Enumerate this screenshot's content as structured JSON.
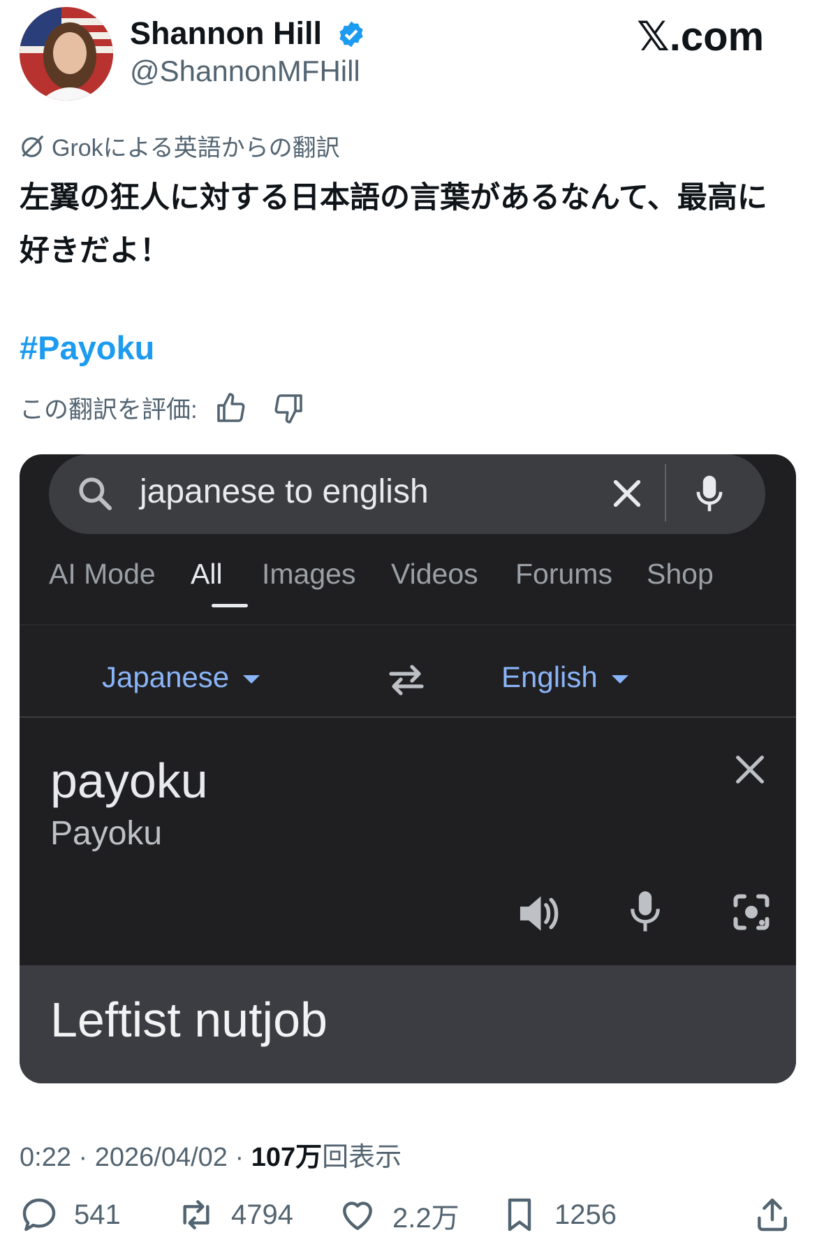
{
  "author": {
    "display_name": "Shannon Hill",
    "handle": "@ShannonMFHill",
    "verified": true
  },
  "site_label": "𝕏.com",
  "translation_note": "Grokによる英語からの翻訳",
  "post_text": "左翼の狂人に対する日本語の言葉があるなんて、最高に好きだよ！",
  "hashtag": "#Payoku",
  "rate_translation_label": "この翻訳を評価:",
  "screenshot": {
    "search_query": "japanese to english",
    "tabs": [
      "AI Mode",
      "All",
      "Images",
      "Videos",
      "Forums",
      "Shop"
    ],
    "active_tab": "All",
    "source_language": "Japanese",
    "target_language": "English",
    "source_text": "payoku",
    "source_romanization": "Payoku",
    "result_text": "Leftist nutjob"
  },
  "meta": {
    "time": "0:22",
    "date": "2026/04/02",
    "views_count": "107万",
    "views_label": "回表示"
  },
  "actions": {
    "replies": "541",
    "reposts": "4794",
    "likes": "2.2万",
    "bookmarks": "1256"
  },
  "colors": {
    "link": "#1d9bf0",
    "secondary_text": "#536471",
    "card_bg": "#1f1f21",
    "lang_blue": "#8ab4f8"
  }
}
